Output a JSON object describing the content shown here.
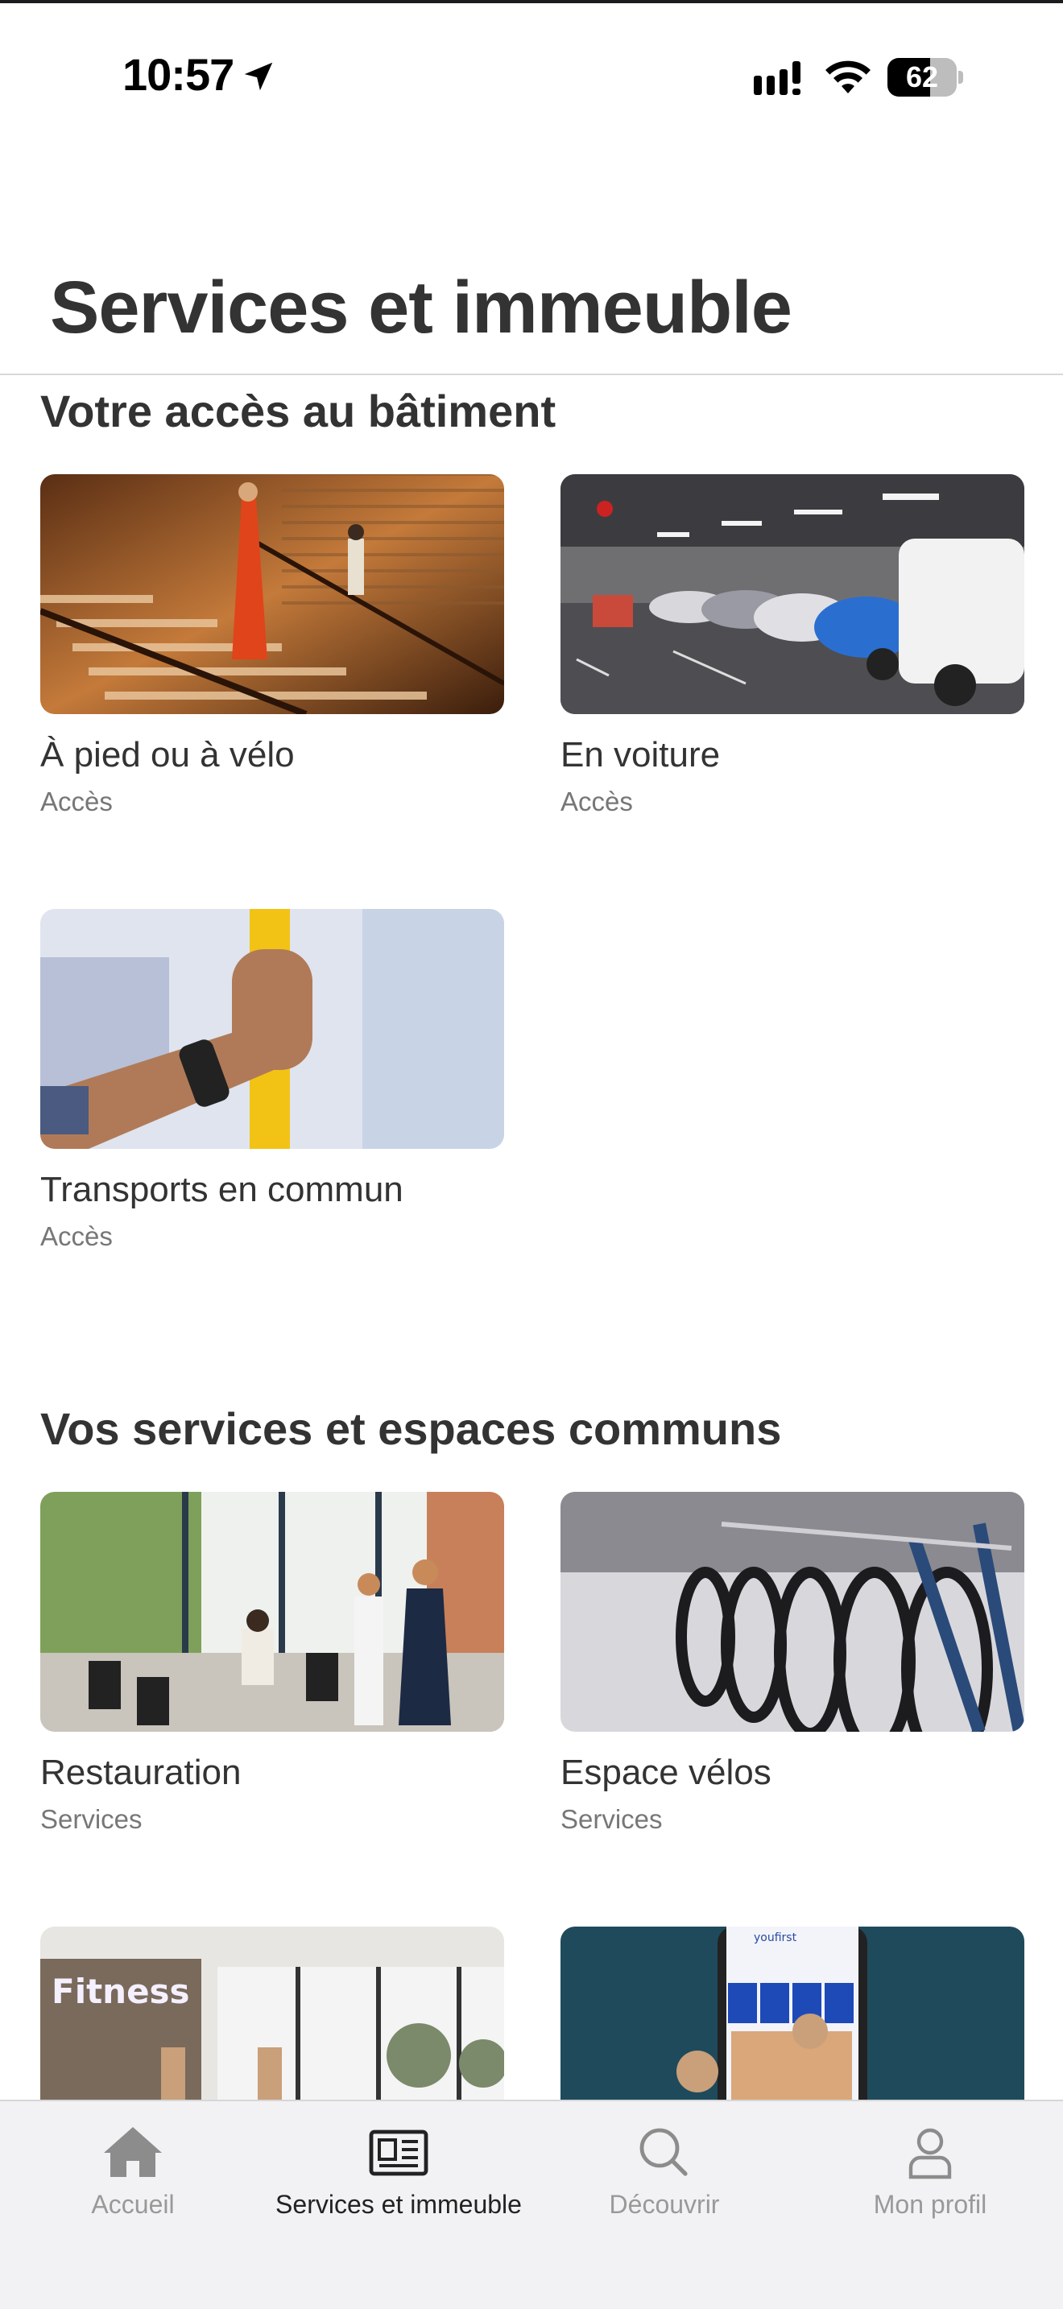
{
  "status_bar": {
    "time": "10:57",
    "battery": "62",
    "battery_level": 0.62
  },
  "header": {
    "title": "Services et immeuble"
  },
  "sections": [
    {
      "title": "Votre accès au bâtiment",
      "cards": [
        {
          "title": "À pied ou à vélo",
          "subtitle": "Accès",
          "image": "stairs-photo"
        },
        {
          "title": "En voiture",
          "subtitle": "Accès",
          "image": "parking-photo"
        },
        {
          "title": "Transports en commun",
          "subtitle": "Accès",
          "image": "transit-handle-photo"
        }
      ]
    },
    {
      "title": "Vos services et espaces communs",
      "cards": [
        {
          "title": "Restauration",
          "subtitle": "Services",
          "image": "cafe-terrace-photo"
        },
        {
          "title": "Espace vélos",
          "subtitle": "Services",
          "image": "bike-rack-photo"
        },
        {
          "title": "",
          "subtitle": "",
          "image": "fitness-photo",
          "image_text": "Fitness"
        },
        {
          "title": "",
          "subtitle": "",
          "image": "phone-app-photo",
          "image_text": "youfirst"
        }
      ]
    }
  ],
  "tab_bar": {
    "tabs": [
      {
        "label": "Accueil",
        "icon": "home-icon",
        "active": false
      },
      {
        "label": "Services et immeuble",
        "icon": "newspaper-icon",
        "active": true
      },
      {
        "label": "Découvrir",
        "icon": "search-icon",
        "active": false
      },
      {
        "label": "Mon profil",
        "icon": "person-icon",
        "active": false
      }
    ]
  },
  "colors": {
    "text": "#333333",
    "muted": "#777777",
    "tab_inactive": "#999999",
    "tab_active": "#222222",
    "tab_bar_bg": "#f2f2f4"
  }
}
